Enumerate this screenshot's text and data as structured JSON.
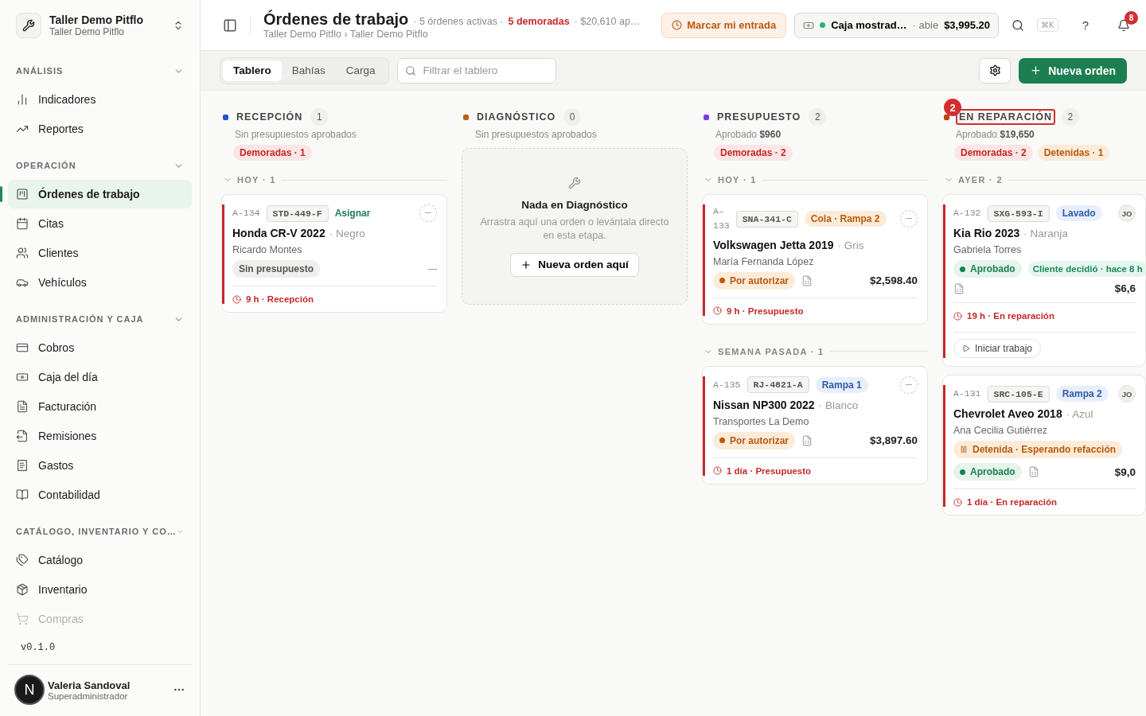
{
  "workspace": {
    "name": "Taller Demo Pitflo",
    "sub": "Taller Demo Pitflo"
  },
  "sidebar": {
    "sections": [
      {
        "title": "ANÁLISIS",
        "expanded": true,
        "items": [
          {
            "label": "Indicadores",
            "selected": false,
            "faded": false
          },
          {
            "label": "Reportes",
            "selected": false,
            "faded": false
          }
        ]
      },
      {
        "title": "OPERACIÓN",
        "expanded": true,
        "items": [
          {
            "label": "Órdenes de trabajo",
            "selected": true,
            "faded": false
          },
          {
            "label": "Citas",
            "selected": false,
            "faded": false
          },
          {
            "label": "Clientes",
            "selected": false,
            "faded": false
          },
          {
            "label": "Vehículos",
            "selected": false,
            "faded": false
          }
        ]
      },
      {
        "title": "ADMINISTRACIÓN Y CAJA",
        "expanded": true,
        "items": [
          {
            "label": "Cobros",
            "selected": false,
            "faded": false
          },
          {
            "label": "Caja del día",
            "selected": false,
            "faded": false
          },
          {
            "label": "Facturación",
            "selected": false,
            "faded": false
          },
          {
            "label": "Remisiones",
            "selected": false,
            "faded": false
          },
          {
            "label": "Gastos",
            "selected": false,
            "faded": false
          },
          {
            "label": "Contabilidad",
            "selected": false,
            "faded": false
          }
        ]
      },
      {
        "title": "CATÁLOGO, INVENTARIO Y CO…",
        "expanded": true,
        "items": [
          {
            "label": "Catálogo",
            "selected": false,
            "faded": false
          },
          {
            "label": "Inventario",
            "selected": false,
            "faded": false
          },
          {
            "label": "Compras",
            "selected": false,
            "faded": true
          }
        ]
      }
    ],
    "version": "v0.1.0",
    "user": {
      "initial": "N",
      "name": "Valeria Sandoval",
      "role": "Superadministrador"
    }
  },
  "header": {
    "title": "Órdenes de trabajo",
    "stats": [
      {
        "text": "· 5 órdenes activas ·",
        "kind": "muted"
      },
      {
        "text": "5 demoradas",
        "kind": "alert"
      },
      {
        "text": "· $20,610 ap…",
        "kind": "muted"
      }
    ],
    "breadcrumb": "Taller Demo Pitflo › Taller Demo Pitflo",
    "clock_button": "Marcar mi entrada",
    "cash": {
      "name": "Caja mostrad…",
      "status": "· abie",
      "amount": "$3,995.20"
    },
    "shortcut": "⌘K",
    "help": "?",
    "notifications": "8"
  },
  "toolbar": {
    "tabs": [
      {
        "label": "Tablero",
        "selected": true
      },
      {
        "label": "Bahías",
        "selected": false
      },
      {
        "label": "Carga",
        "selected": false
      }
    ],
    "filter": {
      "placeholder": "Filtrar el tablero"
    },
    "new_button": "Nueva orden"
  },
  "columns": [
    {
      "title": "RECEPCIÓN",
      "color": "#2250d8",
      "count": "1",
      "summary": "Sin presupuestos aprobados",
      "chips": [
        {
          "text": "Demoradas · 1",
          "kind": "late"
        }
      ],
      "groups": [
        {
          "label": "HOY · 1",
          "cards": [
            {
              "id": "A-134",
              "plate": "STD-449-F",
              "tag": {
                "text": "Asignar",
                "kind": "assign"
              },
              "rows": [
                [
                  {
                    "kind": "none",
                    "text": "Sin presupuesto"
                  },
                  {
                    "kind": "dash"
                  }
                ]
              ],
              "timer": "9 h · Recepción",
              "vehicle": "Honda CR-V 2022",
              "color_name": "· Negro",
              "customer": "Ricardo Montes"
            }
          ]
        }
      ]
    },
    {
      "title": "DIAGNÓSTICO",
      "color": "#c0610f",
      "count": "0",
      "summary": "Sin presupuestos aprobados",
      "empty": {
        "title": "Nada en Diagnóstico",
        "text": "Arrastra aquí una orden o levántala directo en esta etapa.",
        "button": "Nueva orden aquí"
      }
    },
    {
      "title": "PRESUPUESTO",
      "color": "#7c3aed",
      "count": "2",
      "summary": "Aprobado **$960**",
      "chips": [
        {
          "text": "Demoradas · 2",
          "kind": "late"
        }
      ],
      "groups": [
        {
          "label": "HOY · 1",
          "cards": [
            {
              "id": "A–\n133",
              "plate": "SNA-341-C",
              "tag": {
                "text": "Cola · Rampa 2",
                "kind": "queue"
              },
              "rows": [
                [
                  {
                    "kind": "pending",
                    "text": "Por autorizar"
                  },
                  {
                    "kind": "doc"
                  },
                  {
                    "kind": "amount",
                    "text": "$2,598.40"
                  }
                ]
              ],
              "timer": "9 h · Presupuesto",
              "vehicle": "Volkswagen Jetta 2019",
              "color_name": "· Gris",
              "customer": "María Fernanda López"
            }
          ]
        },
        {
          "label": "SEMANA PASADA · 1",
          "cards": [
            {
              "id": "A-135",
              "plate": "RJ-4821-A",
              "tag": {
                "text": "Rampa 1",
                "kind": "bay"
              },
              "rows": [
                [
                  {
                    "kind": "pending",
                    "text": "Por autorizar"
                  },
                  {
                    "kind": "doc"
                  },
                  {
                    "kind": "amount",
                    "text": "$3,897.60"
                  }
                ]
              ],
              "timer": "1 día · Presupuesto",
              "vehicle": "Nissan NP300 2022",
              "color_name": "· Blanco",
              "customer": "Transportes La Demo"
            }
          ]
        }
      ]
    },
    {
      "title": "EN REPARACIÓN",
      "color": "#c2410c",
      "count": "2",
      "annotation": "2",
      "summary": "Aprobado **$19,650**",
      "chips": [
        {
          "text": "Demoradas · 2",
          "kind": "late"
        },
        {
          "text": "Detenidas · 1",
          "kind": "held"
        }
      ],
      "groups": [
        {
          "label": "AYER · 2",
          "cards": [
            {
              "id": "A-132",
              "plate": "SXG-593-I",
              "tag": {
                "text": "Lavado",
                "kind": "bay"
              },
              "assignee": "JO",
              "rows": [
                [
                  {
                    "kind": "approved",
                    "text": "Aprobado"
                  },
                  {
                    "kind": "decision",
                    "text": "Cliente decidió · hace 8 h"
                  }
                ],
                [
                  {
                    "kind": "doc"
                  },
                  {
                    "kind": "amount",
                    "text": "$6,6"
                  }
                ]
              ],
              "timer": "19 h · En reparación",
              "vehicle": "Kia Rio 2023",
              "color_name": "· Naranja",
              "customer": "Gabriela Torres",
              "action": "Iniciar trabajo"
            },
            {
              "id": "A-131",
              "plate": "SRC-105-E",
              "tag": {
                "text": "Rampa 2",
                "kind": "bay"
              },
              "assignee": "JO",
              "rows": [
                [
                  {
                    "kind": "held",
                    "text": "Detenida · Esperando refacción"
                  }
                ],
                [
                  {
                    "kind": "approved",
                    "text": "Aprobado"
                  },
                  {
                    "kind": "doc"
                  },
                  {
                    "kind": "amount",
                    "text": "$9,0"
                  }
                ]
              ],
              "timer": "1 día · En reparación",
              "vehicle": "Chevrolet Aveo 2018",
              "color_name": "· Azul",
              "customer": "Ana Cecilia Gutiérrez"
            }
          ]
        }
      ]
    }
  ]
}
